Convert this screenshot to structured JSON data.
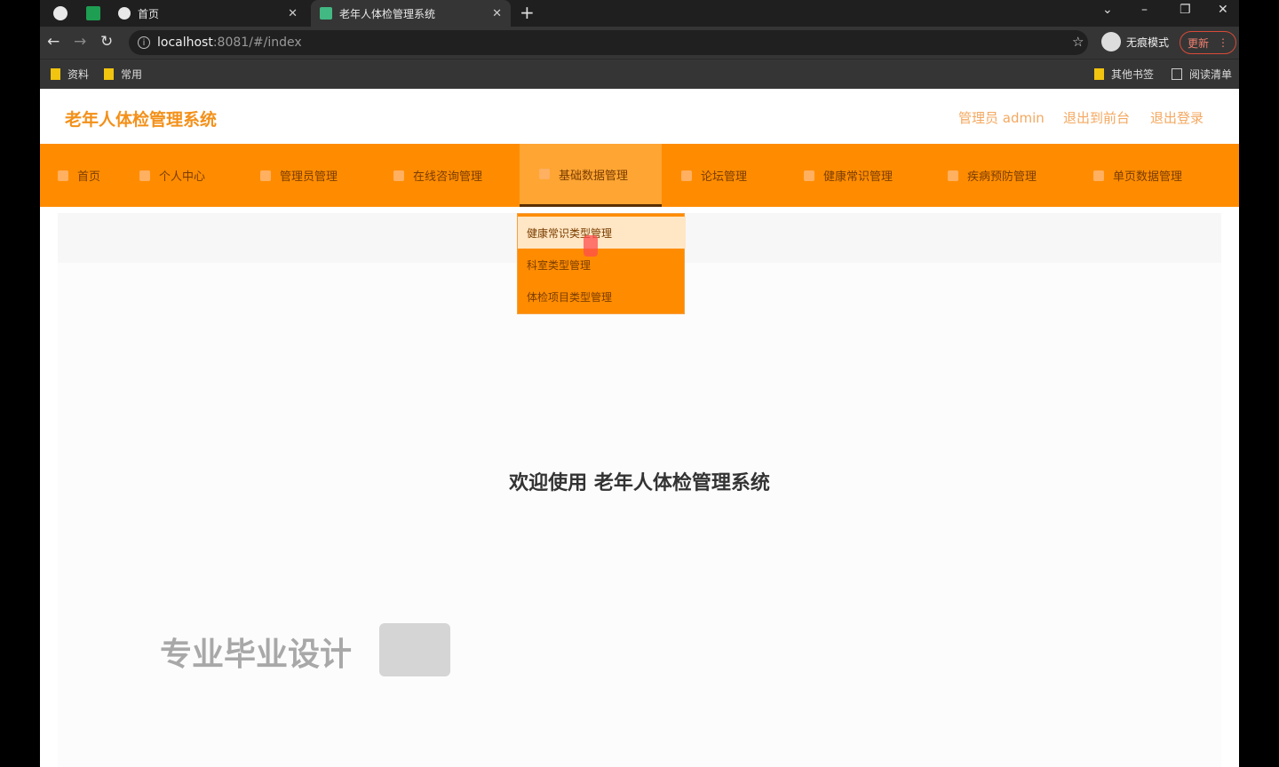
{
  "browser": {
    "tabs": [
      {
        "label": "首页"
      },
      {
        "label": "老年人体检管理系统"
      }
    ],
    "address": {
      "host": "localhost",
      "path": ":8081/#/index"
    },
    "profile_label": "无痕模式",
    "update_label": "更新",
    "bookmarks": [
      {
        "label": "资料"
      },
      {
        "label": "常用"
      },
      {
        "label": "其他书签"
      },
      {
        "label": "阅读清单"
      }
    ]
  },
  "header": {
    "title": "老年人体检管理系统",
    "user": "管理员 admin",
    "exit_to_front": "退出到前台",
    "logout": "退出登录"
  },
  "menu": {
    "items": [
      {
        "label": "首页"
      },
      {
        "label": "个人中心"
      },
      {
        "label": "管理员管理"
      },
      {
        "label": "在线咨询管理"
      },
      {
        "label": "基础数据管理"
      },
      {
        "label": "论坛管理"
      },
      {
        "label": "健康常识管理"
      },
      {
        "label": "疾病预防管理"
      },
      {
        "label": "单页数据管理"
      }
    ],
    "active_index": 4,
    "dropdown": [
      {
        "label": "健康常识类型管理"
      },
      {
        "label": "科室类型管理"
      },
      {
        "label": "体检项目类型管理"
      }
    ]
  },
  "main": {
    "welcome": "欢迎使用 老年人体检管理系统",
    "watermark": "专业毕业设计"
  },
  "colors": {
    "accent": "#ff8c00",
    "title": "#f39019"
  }
}
